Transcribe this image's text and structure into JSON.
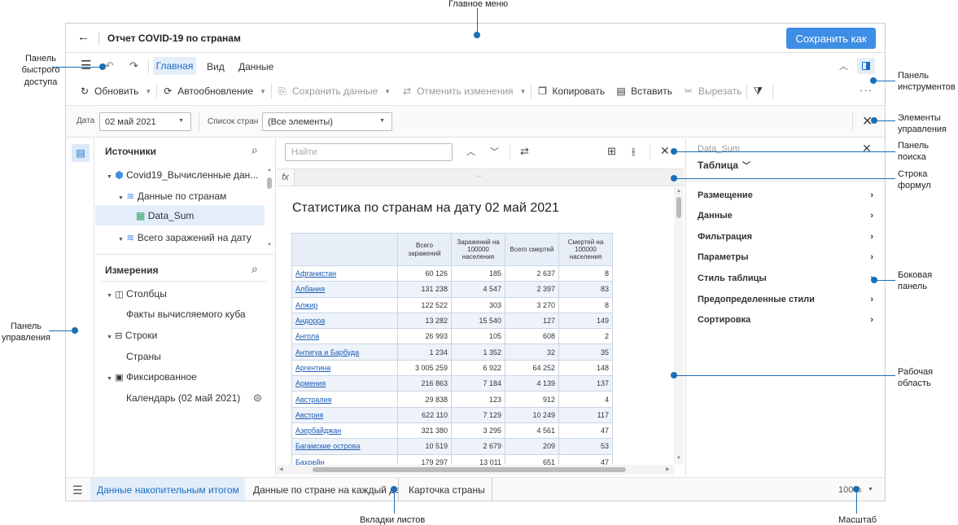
{
  "annotations": {
    "main_menu": "Главное меню",
    "quick_access": [
      "Панель",
      "быстрого",
      "доступа"
    ],
    "toolbar": [
      "Панель",
      "инструментов"
    ],
    "controls": [
      "Элементы",
      "управления"
    ],
    "search_panel": [
      "Панель",
      "поиска"
    ],
    "formula_bar": [
      "Строка",
      "формул"
    ],
    "side_panel": [
      "Боковая",
      "панель"
    ],
    "workspace": [
      "Рабочая",
      "область"
    ],
    "control_panel": [
      "Панель",
      "управления"
    ],
    "sheet_tabs": "Вкладки листов",
    "scale": "Масштаб"
  },
  "header": {
    "title": "Отчет COVID-19 по странам",
    "save_as": "Сохранить как"
  },
  "ribbon_tabs": [
    "Главная",
    "Вид",
    "Данные"
  ],
  "toolbar": {
    "refresh": "Обновить",
    "autorefresh": "Автообновление",
    "save_data": "Сохранить данные",
    "undo_changes": "Отменить изменения",
    "copy": "Копировать",
    "paste": "Вставить",
    "cut": "Вырезать"
  },
  "controls": {
    "date_label": "Дата",
    "date_value": "02 май 2021",
    "countries_label": "Список стран",
    "countries_value": "(Все элементы)"
  },
  "sources": {
    "title": "Источники",
    "items": [
      "Covid19_Вычисленные дан...",
      "Данные по странам",
      "Data_Sum",
      "Всего заражений на дату"
    ]
  },
  "dimensions": {
    "title": "Измерения",
    "columns": "Столбцы",
    "columns_item": "Факты вычисляемого куба",
    "rows": "Строки",
    "rows_item": "Страны",
    "fixed": "Фиксированное",
    "fixed_item": "Календарь (02 май 2021)"
  },
  "search": {
    "placeholder": "Найти"
  },
  "formula": {
    "fx": "fx"
  },
  "report": {
    "title": "Статистика по странам на дату 02 май 2021",
    "headers": [
      "Всего заражений",
      "Заражений на 100000 населения",
      "Всего смертей",
      "Смертей на 100000 населения"
    ],
    "rows": [
      [
        "Афганистан",
        "60 126",
        "185",
        "2 637",
        "8"
      ],
      [
        "Албания",
        "131 238",
        "4 547",
        "2 397",
        "83"
      ],
      [
        "Алжир",
        "122 522",
        "303",
        "3 270",
        "8"
      ],
      [
        "Андорра",
        "13 282",
        "15 540",
        "127",
        "149"
      ],
      [
        "Ангола",
        "26 993",
        "105",
        "608",
        "2"
      ],
      [
        "Антигуа и Барбуда",
        "1 234",
        "1 352",
        "32",
        "35"
      ],
      [
        "Аргентина",
        "3 005 259",
        "6 922",
        "64 252",
        "148"
      ],
      [
        "Армения",
        "216 863",
        "7 184",
        "4 139",
        "137"
      ],
      [
        "Австралия",
        "29 838",
        "123",
        "912",
        "4"
      ],
      [
        "Австрия",
        "622 110",
        "7 129",
        "10 249",
        "117"
      ],
      [
        "Азербайджан",
        "321 380",
        "3 295",
        "4 561",
        "47"
      ],
      [
        "Багамские острова",
        "10 519",
        "2 679",
        "209",
        "53"
      ],
      [
        "Бахрейн",
        "179 297",
        "13 011",
        "651",
        "47"
      ]
    ]
  },
  "side_panel": {
    "object": "Data_Sum",
    "type": "Таблица",
    "items": [
      "Размещение",
      "Данные",
      "Фильтрация",
      "Параметры",
      "Стиль таблицы",
      "Предопределенные стили",
      "Сортировка"
    ]
  },
  "sheets": [
    "Данные накопительным итогом",
    "Данные по стране на каждый де",
    "Карточка страны"
  ],
  "zoom": "100%"
}
